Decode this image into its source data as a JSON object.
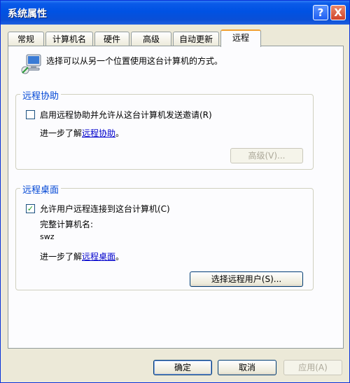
{
  "window": {
    "title": "系统属性",
    "help_label": "?",
    "close_label": "X"
  },
  "tabs": [
    {
      "label": "常规"
    },
    {
      "label": "计算机名"
    },
    {
      "label": "硬件"
    },
    {
      "label": "高级"
    },
    {
      "label": "自动更新"
    },
    {
      "label": "远程"
    }
  ],
  "intro": {
    "text": "选择可以从另一个位置使用这台计算机的方式。"
  },
  "remote_assistance": {
    "title": "远程协助",
    "checkbox_label": "启用远程协助并允许从这台计算机发送邀请(R)",
    "checked": false,
    "more_prefix": "进一步了解",
    "more_link": "远程协助",
    "more_suffix": "。",
    "advanced_button": "高级(V)..."
  },
  "remote_desktop": {
    "title": "远程桌面",
    "checkbox_label": "允许用户远程连接到这台计算机(C)",
    "checked": true,
    "checkmark": "✓",
    "computer_name_label": "完整计算机名:",
    "computer_name_value": "swz",
    "more_prefix": "进一步了解",
    "more_link": "远程桌面",
    "more_suffix": "。",
    "select_users_button": "选择远程用户(S)..."
  },
  "footer": {
    "ok": "确定",
    "cancel": "取消",
    "apply": "应用(A)"
  },
  "colors": {
    "titlebar": "#0052e3",
    "group_title": "#0046d5",
    "link": "#0000cc"
  }
}
